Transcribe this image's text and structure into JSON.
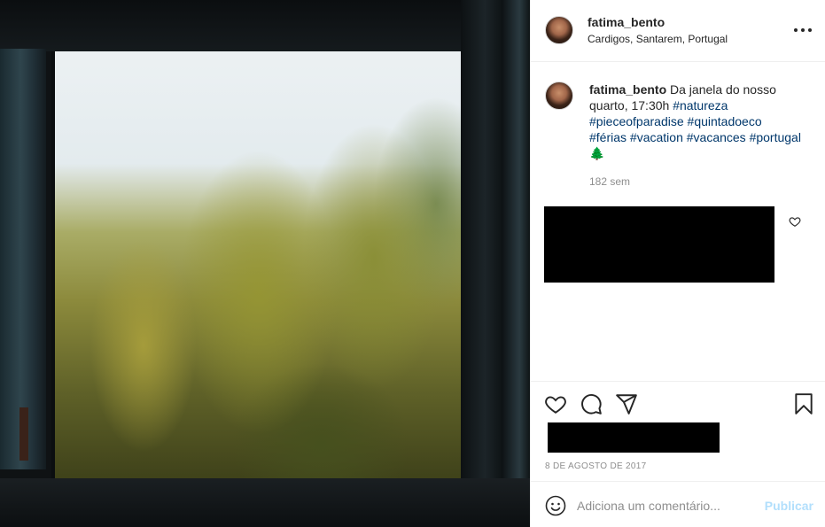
{
  "post": {
    "username": "fatima_bento",
    "location": "Cardigos, Santarem, Portugal",
    "caption_user": "fatima_bento",
    "caption_text": "Da janela do nosso quarto, 17:30h",
    "hashtags": [
      "#natureza",
      "#pieceofparadise",
      "#quintadoeco",
      "#férias",
      "#vacation",
      "#vacances",
      "#portugal"
    ],
    "caption_emoji": "🌲",
    "caption_time": "182 sem",
    "date": "8 DE AGOSTO DE 2017"
  },
  "icons": {
    "more": "more-options-icon",
    "like": "heart-icon",
    "comment": "comment-bubble-icon",
    "share": "paper-plane-icon",
    "save": "bookmark-icon",
    "emoji": "smiley-icon"
  },
  "comment_box": {
    "placeholder": "Adiciona um comentário...",
    "publish_label": "Publicar"
  },
  "colors": {
    "hashtag": "#00376b",
    "publish_disabled": "#b2dffc",
    "meta_gray": "#8e8e8e"
  }
}
